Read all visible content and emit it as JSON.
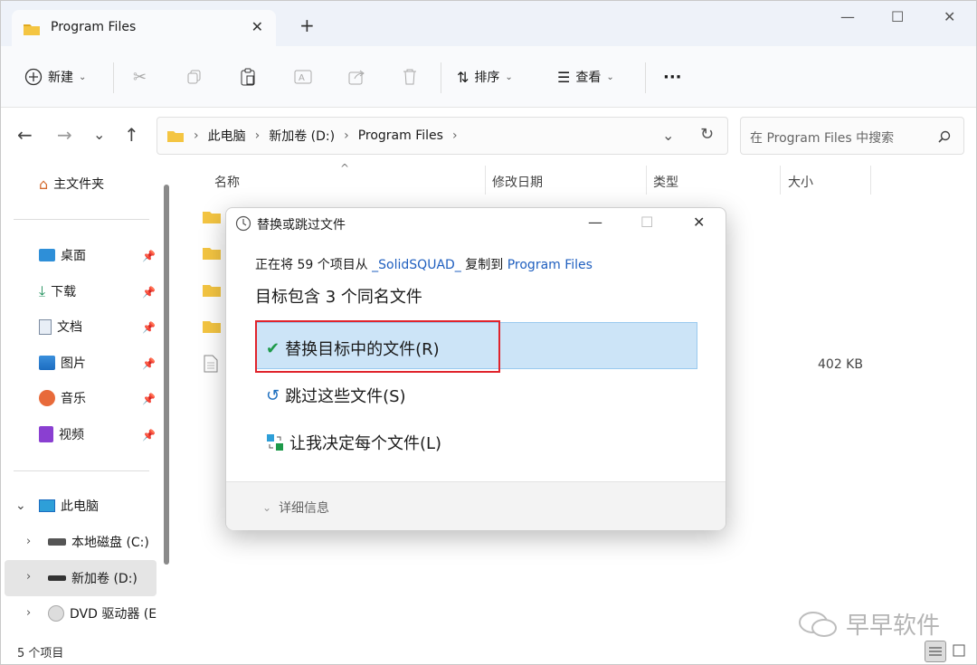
{
  "window": {
    "tab_title": "Program Files",
    "tab_close": "✕",
    "new_tab": "+",
    "minimize": "—",
    "maximize": "☐",
    "close": "✕"
  },
  "toolbar": {
    "new_label": "新建",
    "sort_label": "排序",
    "view_label": "查看",
    "more_label": "···"
  },
  "address": {
    "crumbs": [
      "此电脑",
      "新加卷 (D:)",
      "Program Files"
    ],
    "search_placeholder": "在 Program Files 中搜索"
  },
  "sidebar": {
    "home": "主文件夹",
    "quick": [
      {
        "label": "桌面",
        "icon": "desktop-icon"
      },
      {
        "label": "下载",
        "icon": "download-icon"
      },
      {
        "label": "文档",
        "icon": "document-icon"
      },
      {
        "label": "图片",
        "icon": "pictures-icon"
      },
      {
        "label": "音乐",
        "icon": "music-icon"
      },
      {
        "label": "视频",
        "icon": "video-icon"
      }
    ],
    "this_pc": "此电脑",
    "drives": [
      "本地磁盘 (C:)",
      "新加卷 (D:)",
      "DVD 驱动器 (E"
    ]
  },
  "list": {
    "columns": [
      "名称",
      "修改日期",
      "类型",
      "大小"
    ],
    "file_size": "402 KB"
  },
  "status": {
    "item_count": "5 个项目"
  },
  "dialog": {
    "title": "替换或跳过文件",
    "prefix": "正在将 59 个项目从 ",
    "source": "_SolidSQUAD_",
    "middle": " 复制到 ",
    "dest": "Program Files",
    "conflict": "目标包含 3 个同名文件",
    "option_replace": "替换目标中的文件(R)",
    "option_skip": "跳过这些文件(S)",
    "option_decide": "让我决定每个文件(L)",
    "details": "详细信息"
  },
  "watermark": "早早软件",
  "colors": {
    "accent": "#1f5fbf",
    "highlight": "#cce4f7",
    "red_box": "#e0242c",
    "folder": "#f4c542"
  }
}
